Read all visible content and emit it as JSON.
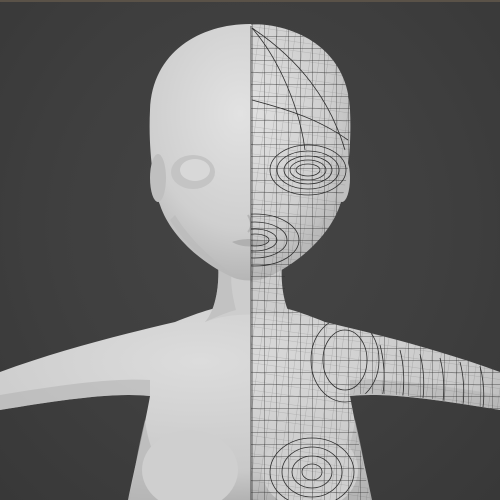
{
  "viewport": {
    "background": "#3d3d3d",
    "model_color": "#d6d6d6",
    "wire_color": "#2e2e2e",
    "mode": "half-wireframe"
  }
}
